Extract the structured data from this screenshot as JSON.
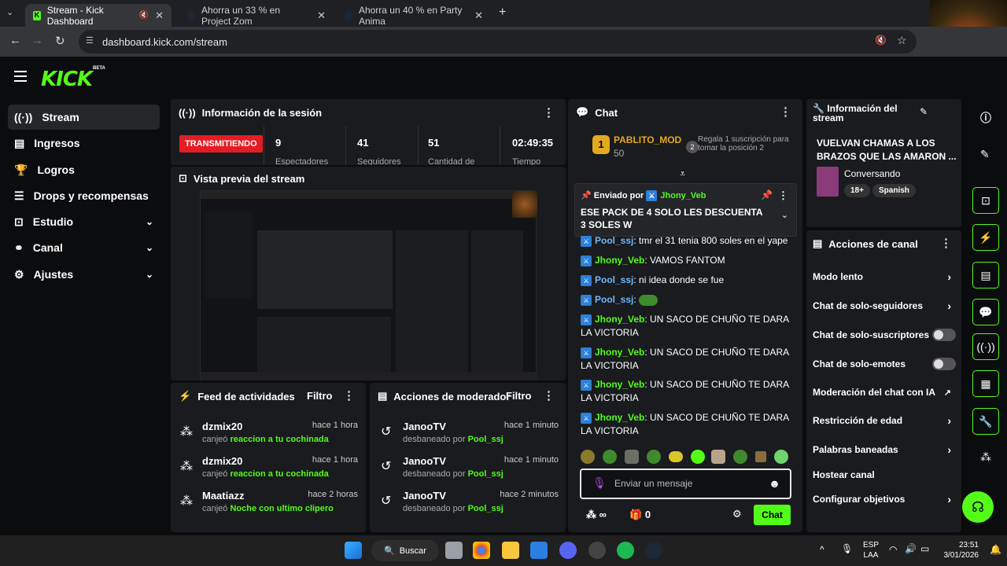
{
  "browser": {
    "tabs": [
      {
        "title": "Stream - Kick Dashboard"
      },
      {
        "title": "Ahorra un 33 % en Project Zom"
      },
      {
        "title": "Ahorra un 40 % en Party Anima"
      }
    ],
    "url": "dashboard.kick.com/stream"
  },
  "sidebar": {
    "items": [
      {
        "label": "Stream"
      },
      {
        "label": "Ingresos"
      },
      {
        "label": "Logros"
      },
      {
        "label": "Drops y recompensas"
      },
      {
        "label": "Estudio"
      },
      {
        "label": "Canal"
      },
      {
        "label": "Ajustes"
      }
    ]
  },
  "header": {
    "logo": "KICK",
    "beta": "BETA"
  },
  "session": {
    "title": "Información de la sesión",
    "status": "TRANSMITIENDO",
    "metrics": [
      {
        "value": "9",
        "label": "Espectadores"
      },
      {
        "value": "41",
        "label": "Seguidores"
      },
      {
        "value": "51",
        "label": "Cantidad de"
      },
      {
        "value": "02:49:35",
        "label": "Tiempo"
      }
    ]
  },
  "preview": {
    "title": "Vista previa del stream"
  },
  "feed": {
    "title": "Feed de actividades",
    "filter": "Filtro",
    "rows": [
      {
        "name": "dzmix20",
        "time": "hace 1 hora",
        "verb": "canjeó",
        "reward": "reaccion a tu cochinada"
      },
      {
        "name": "dzmix20",
        "time": "hace 1 hora",
        "verb": "canjeó",
        "reward": "reaccion a tu cochinada"
      },
      {
        "name": "Maatiazz",
        "time": "hace 2 horas",
        "verb": "canjeó",
        "reward": "Noche con ultimo clipero"
      }
    ]
  },
  "mod": {
    "title": "Acciones de moderador",
    "filter": "Filtro",
    "rows": [
      {
        "name": "JanooTV",
        "time": "hace 1 minuto",
        "verb": "desbaneado por",
        "by": "Pool_ssj"
      },
      {
        "name": "JanooTV",
        "time": "hace 1 minuto",
        "verb": "desbaneado por",
        "by": "Pool_ssj"
      },
      {
        "name": "JanooTV",
        "time": "hace 2 minutos",
        "verb": "desbaneado por",
        "by": "Pool_ssj"
      }
    ]
  },
  "chat": {
    "title": "Chat",
    "top": {
      "rank": "1",
      "name": "PABLITO_MOD",
      "amount": "50",
      "hint": "Regala 1 suscripción para tomar la posición 2",
      "hint_rank": "2"
    },
    "pinned": {
      "label": "Enviado por",
      "user": "Jhony_Veb",
      "text": "ESE PACK DE 4 SOLO LES DESCUENTA 3 SOLES W"
    },
    "messages": [
      {
        "user": "Pool_ssj",
        "text": "tmr el 31 tenia 800 soles en el yape"
      },
      {
        "user": "Jhony_Veb",
        "text": "VAMOS FANTOM"
      },
      {
        "user": "Pool_ssj",
        "text": "ni idea donde se fue"
      },
      {
        "user": "Pool_ssj",
        "text": ""
      },
      {
        "user": "Jhony_Veb",
        "text": "UN SACO DE CHUÑO TE DARA LA VICTORIA"
      },
      {
        "user": "Jhony_Veb",
        "text": "UN SACO DE CHUÑO TE DARA LA VICTORIA"
      },
      {
        "user": "Jhony_Veb",
        "text": "UN SACO DE CHUÑO TE DARA LA VICTORIA"
      },
      {
        "user": "Jhony_Veb",
        "text": "UN SACO DE CHUÑO TE DARA LA VICTORIA"
      }
    ],
    "placeholder": "Enviar un mensaje",
    "infinite": "∞",
    "count": "0",
    "send": "Chat"
  },
  "streaminfo": {
    "title": "Información del stream",
    "stream_title": "VUELVAN CHAMAS A LOS BRAZOS QUE LAS AMARON ...",
    "category": "Conversando",
    "tags": [
      "18+",
      "Spanish"
    ]
  },
  "actions": {
    "title": "Acciones de canal",
    "items": [
      {
        "label": "Modo lento",
        "kind": "arrow"
      },
      {
        "label": "Chat de solo-seguidores",
        "kind": "arrow"
      },
      {
        "label": "Chat de solo-suscriptores",
        "kind": "toggle"
      },
      {
        "label": "Chat de solo-emotes",
        "kind": "toggle"
      },
      {
        "label": "Moderación del chat con IA",
        "kind": "link"
      },
      {
        "label": "Restricción de edad",
        "kind": "arrow"
      },
      {
        "label": "Palabras baneadas",
        "kind": "arrow"
      },
      {
        "label": "Hostear canal",
        "kind": "none"
      },
      {
        "label": "Configurar objetivos",
        "kind": "arrow"
      }
    ]
  },
  "taskbar": {
    "search": "Buscar",
    "lang": "ESP",
    "layout": "LAA",
    "time": "23:51",
    "date": "3/01/2026"
  },
  "colors": {
    "accent": "#53fc18",
    "live": "#e51c23",
    "panel": "#191b1f"
  }
}
